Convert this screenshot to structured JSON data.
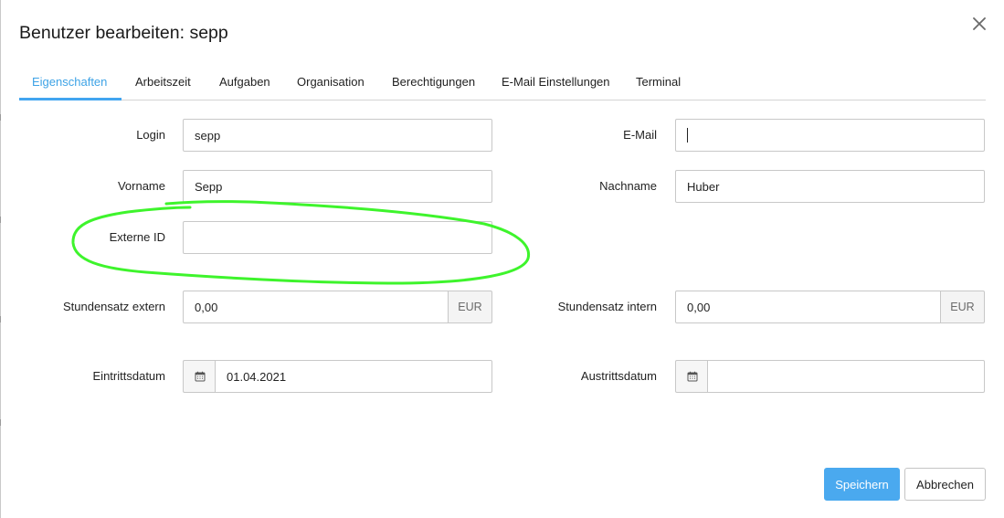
{
  "dialog": {
    "title": "Benutzer bearbeiten: sepp"
  },
  "tabs": [
    {
      "label": "Eigenschaften",
      "active": true
    },
    {
      "label": "Arbeitszeit"
    },
    {
      "label": "Aufgaben"
    },
    {
      "label": "Organisation"
    },
    {
      "label": "Berechtigungen"
    },
    {
      "label": "E-Mail Einstellungen"
    },
    {
      "label": "Terminal"
    }
  ],
  "form": {
    "login": {
      "label": "Login",
      "value": "sepp"
    },
    "email": {
      "label": "E-Mail",
      "value": ""
    },
    "vorname": {
      "label": "Vorname",
      "value": "Sepp"
    },
    "nachname": {
      "label": "Nachname",
      "value": "Huber"
    },
    "externe_id": {
      "label": "Externe ID",
      "value": ""
    },
    "stundensatz_extern": {
      "label": "Stundensatz extern",
      "value": "0,00",
      "unit": "EUR"
    },
    "stundensatz_intern": {
      "label": "Stundensatz intern",
      "value": "0,00",
      "unit": "EUR"
    },
    "eintrittsdatum": {
      "label": "Eintrittsdatum",
      "value": "01.04.2021"
    },
    "austrittsdatum": {
      "label": "Austrittsdatum",
      "value": ""
    }
  },
  "buttons": {
    "save": "Speichern",
    "cancel": "Abbrechen"
  },
  "colors": {
    "accent": "#42a5f0",
    "primary_button": "#4aa9ef",
    "annotation": "#3ef42c"
  },
  "icons": {
    "close": "close-icon",
    "calendar": "calendar-icon"
  }
}
